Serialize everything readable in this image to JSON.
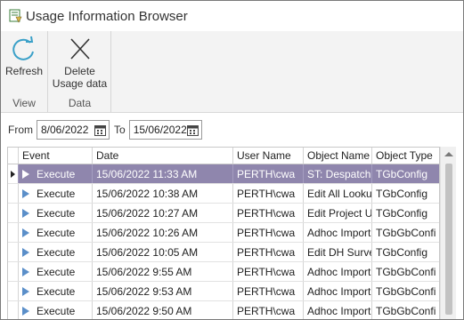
{
  "window": {
    "title": "Usage Information Browser"
  },
  "ribbon": {
    "groups": [
      {
        "label": "View",
        "buttons": [
          {
            "label": "Refresh",
            "icon": "refresh-icon"
          }
        ]
      },
      {
        "label": "Data",
        "buttons": [
          {
            "label_line1": "Delete",
            "label_line2": "Usage data",
            "icon": "close-icon"
          }
        ]
      }
    ]
  },
  "filter": {
    "from_label": "From",
    "from_value": "8/06/2022",
    "to_label": "To",
    "to_value": "15/06/2022"
  },
  "grid": {
    "columns": [
      "Event",
      "Date",
      "User Name",
      "Object Name",
      "Object Type"
    ],
    "rows": [
      {
        "event": "Execute",
        "date": "15/06/2022 11:33 AM",
        "user": "PERTH\\cwa",
        "object_name": "ST: Despatch I",
        "object_type": "TGbConfig",
        "selected": true
      },
      {
        "event": "Execute",
        "date": "15/06/2022 10:38 AM",
        "user": "PERTH\\cwa",
        "object_name": "Edit All Looku",
        "object_type": "TGbConfig"
      },
      {
        "event": "Execute",
        "date": "15/06/2022 10:27 AM",
        "user": "PERTH\\cwa",
        "object_name": "Edit Project Us",
        "object_type": "TGbConfig"
      },
      {
        "event": "Execute",
        "date": "15/06/2022 10:26 AM",
        "user": "PERTH\\cwa",
        "object_name": "Adhoc Import",
        "object_type": "TGbGbConfi"
      },
      {
        "event": "Execute",
        "date": "15/06/2022 10:05 AM",
        "user": "PERTH\\cwa",
        "object_name": "Edit DH Surve",
        "object_type": "TGbConfig"
      },
      {
        "event": "Execute",
        "date": "15/06/2022 9:55 AM",
        "user": "PERTH\\cwa",
        "object_name": "Adhoc Import",
        "object_type": "TGbGbConfi"
      },
      {
        "event": "Execute",
        "date": "15/06/2022 9:53 AM",
        "user": "PERTH\\cwa",
        "object_name": "Adhoc Import",
        "object_type": "TGbGbConfi"
      },
      {
        "event": "Execute",
        "date": "15/06/2022 9:50 AM",
        "user": "PERTH\\cwa",
        "object_name": "Adhoc Import",
        "object_type": "TGbGbConfi"
      }
    ]
  },
  "colors": {
    "selection": "#8f86ad",
    "accent": "#5b8fc9"
  }
}
